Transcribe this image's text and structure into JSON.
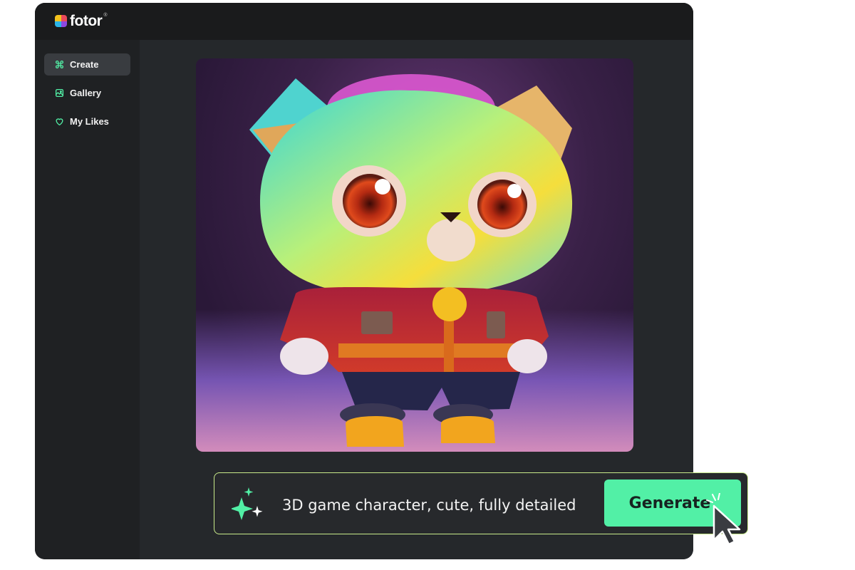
{
  "app": {
    "logo_text": "fotor",
    "logo_reg": "®",
    "colors": {
      "accent": "#52f0a6",
      "prompt_border": "#c8eb8a",
      "panel": "#25282b",
      "sidebar": "#1f2123",
      "topbar": "#1a1b1c"
    }
  },
  "sidebar": {
    "items": [
      {
        "label": "Create",
        "icon": "command-icon",
        "active": true
      },
      {
        "label": "Gallery",
        "icon": "image-icon",
        "active": false
      },
      {
        "label": "My Likes",
        "icon": "heart-icon",
        "active": false
      }
    ]
  },
  "main": {
    "artwork": {
      "subject": "generated-artwork"
    }
  },
  "prompt": {
    "icon": "sparkle-icon",
    "value": "3D game character, cute, fully detailed",
    "generate_label": "Generate",
    "cursor_icon": "mouse-pointer-icon"
  }
}
